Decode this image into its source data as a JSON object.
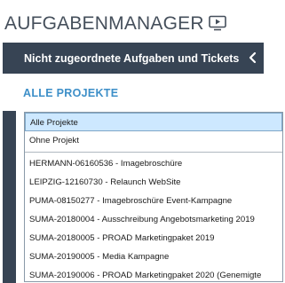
{
  "header": {
    "title": "AUFGABENMANAGER",
    "icon": "play-screen-icon"
  },
  "section": {
    "title": "Nicht zugeordnete Aufgaben und Tickets",
    "collapse_icon": "chevron-left-icon"
  },
  "filter": {
    "label": "ALLE PROJEKTE"
  },
  "dropdown": {
    "options_top": [
      {
        "label": "Alle Projekte",
        "selected": true
      },
      {
        "label": "Ohne Projekt",
        "selected": false
      }
    ],
    "options_projects": [
      {
        "label": "HERMANN-06160536 - Imagebroschüre"
      },
      {
        "label": "LEIPZIG-12160730 - Relaunch WebSite"
      },
      {
        "label": "PUMA-08150277 - Imagebroschüre Event-Kampagne"
      },
      {
        "label": "SUMA-20180004 - Ausschreibung Angebotsmarketing 2019"
      },
      {
        "label": "SUMA-20180005 - PROAD Marketingpaket 2019"
      },
      {
        "label": "SUMA-20190005 - Media Kampagne"
      },
      {
        "label": "SUMA-20190006 - PROAD Marketingpaket 2020 (Genemigte"
      }
    ]
  },
  "colors": {
    "dark_bar": "#374454",
    "accent_blue": "#3d8fc8",
    "selected_bg": "#cde8ff"
  }
}
